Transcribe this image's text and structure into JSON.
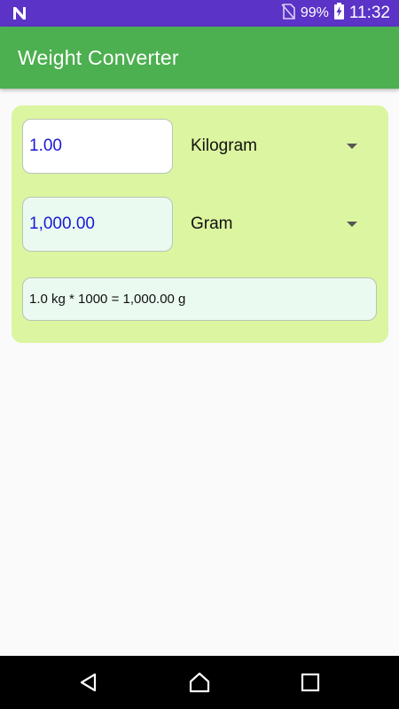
{
  "status_bar": {
    "battery_percent": "99%",
    "time": "11:32"
  },
  "app_bar": {
    "title": "Weight Converter"
  },
  "converter": {
    "from": {
      "value": "1.00",
      "unit": "Kilogram"
    },
    "to": {
      "value": "1,000.00",
      "unit": "Gram"
    },
    "formula": "1.0 kg * 1000 = 1,000.00 g"
  },
  "colors": {
    "status_bar": "#5b33c7",
    "app_bar": "#4caf50",
    "card": "#dcf5a0",
    "value_text": "#1a1ad6"
  },
  "icons": {
    "status_left": "n-notification-icon",
    "no-sim": "no-sim-icon",
    "battery": "battery-charging-icon",
    "nav_back": "back-icon",
    "nav_home": "home-icon",
    "nav_recents": "recents-icon"
  }
}
